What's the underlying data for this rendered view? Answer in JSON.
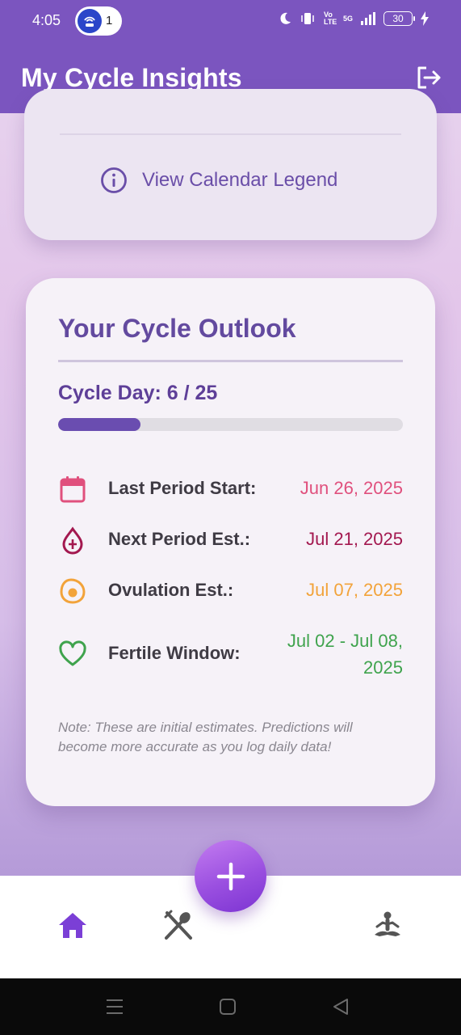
{
  "status_bar": {
    "time": "4:05",
    "hotspot_count": "1",
    "network_label": "Vo LTE",
    "signal_label": "5G",
    "battery": "30"
  },
  "app_bar": {
    "title": "My Cycle Insights",
    "logout_icon": "logout-icon"
  },
  "legend_card": {
    "link_label": "View Calendar Legend",
    "icon": "info-icon"
  },
  "outlook": {
    "title": "Your Cycle Outlook",
    "cycle_day_label": "Cycle Day: 6 / 25",
    "cycle_day": 6,
    "cycle_length": 25,
    "progress_fraction": 0.24,
    "rows": [
      {
        "label": "Last Period Start:",
        "value": "Jun 26, 2025",
        "icon": "calendar-icon",
        "color": "#e0507d"
      },
      {
        "label": "Next Period Est.:",
        "value": "Jul 21, 2025",
        "icon": "blood-drop-icon",
        "color": "#a3184f"
      },
      {
        "label": "Ovulation Est.:",
        "value": "Jul 07, 2025",
        "icon": "egg-icon",
        "color": "#f2a33a"
      },
      {
        "label": "Fertile Window:",
        "value": "Jul 02 - Jul 08, 2025",
        "icon": "heart-icon",
        "color": "#3fa34d"
      }
    ],
    "note": "Note: These are initial estimates. Predictions will become more accurate as you log daily data!"
  },
  "bottom_nav": {
    "items": [
      {
        "name": "home",
        "icon": "home-icon",
        "color": "#7b3fd6"
      },
      {
        "name": "nutrition",
        "icon": "fork-spoon-icon",
        "color": "#555555"
      },
      {
        "name": "meditation",
        "icon": "meditation-icon",
        "color": "#555555"
      }
    ],
    "fab_icon": "plus-icon"
  },
  "colors": {
    "primary": "#7b55bf",
    "title_purple": "#634a9f",
    "progress": "#6a4db0"
  }
}
